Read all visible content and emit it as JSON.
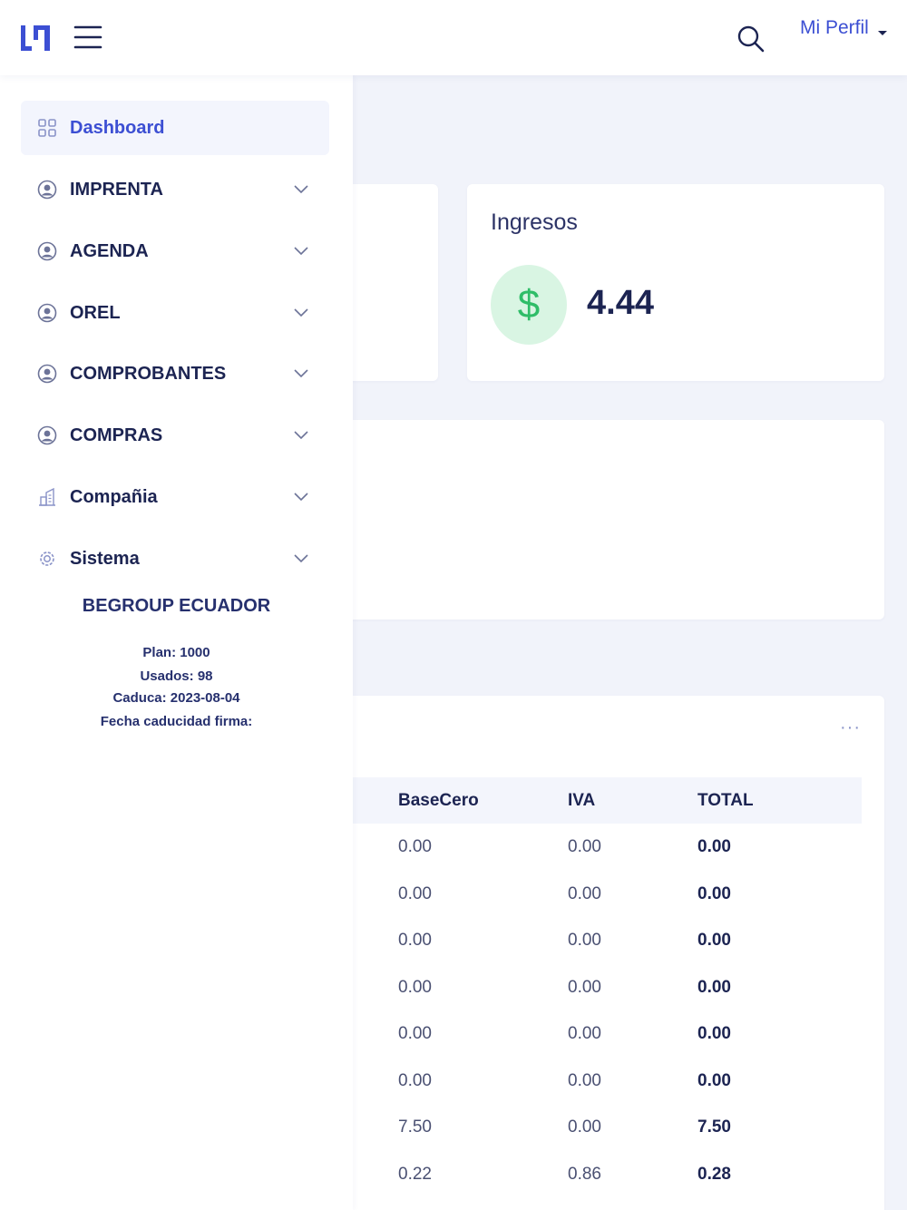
{
  "header": {
    "profile_label": "Mi Perfil",
    "icons": [
      "logo",
      "menu-icon",
      "search-icon",
      "caret-down-icon"
    ]
  },
  "sidebar": {
    "items": [
      {
        "label": "Dashboard",
        "icon": "grid-icon",
        "active": true
      },
      {
        "label": "IMPRENTA",
        "icon": "user-circle-icon"
      },
      {
        "label": "AGENDA",
        "icon": "user-circle-icon"
      },
      {
        "label": "OREL",
        "icon": "user-circle-icon"
      },
      {
        "label": "COMPROBANTES",
        "icon": "user-circle-icon"
      },
      {
        "label": "COMPRAS",
        "icon": "user-circle-icon"
      },
      {
        "label": "Compañia",
        "icon": "building-icon"
      },
      {
        "label": "Sistema",
        "icon": "gear-icon"
      }
    ],
    "company": {
      "name": "BEGROUP ECUADOR",
      "plan": "Plan: 1000",
      "usados": "Usados: 98",
      "caduca": "Caduca: 2023-08-04",
      "firma": "Fecha caducidad firma:"
    }
  },
  "main": {
    "ingresos": {
      "title": "Ingresos",
      "symbol": "$",
      "value": "4.44"
    },
    "table": {
      "more_label": "···",
      "headers": [
        "BaseCero",
        "IVA",
        "TOTAL"
      ],
      "rows": [
        [
          "0.00",
          "0.00",
          "0.00"
        ],
        [
          "0.00",
          "0.00",
          "0.00"
        ],
        [
          "0.00",
          "0.00",
          "0.00"
        ],
        [
          "0.00",
          "0.00",
          "0.00"
        ],
        [
          "0.00",
          "0.00",
          "0.00"
        ],
        [
          "0.00",
          "0.00",
          "0.00"
        ],
        [
          "7.50",
          "0.00",
          "7.50"
        ],
        [
          "0.22",
          "0.86",
          "0.28"
        ]
      ]
    }
  },
  "colors": {
    "accent": "#3c4fd3",
    "text_dark": "#1c2452",
    "background": "#f1f3fa",
    "success_bg": "#d9f5e3",
    "success": "#2fbd68"
  }
}
